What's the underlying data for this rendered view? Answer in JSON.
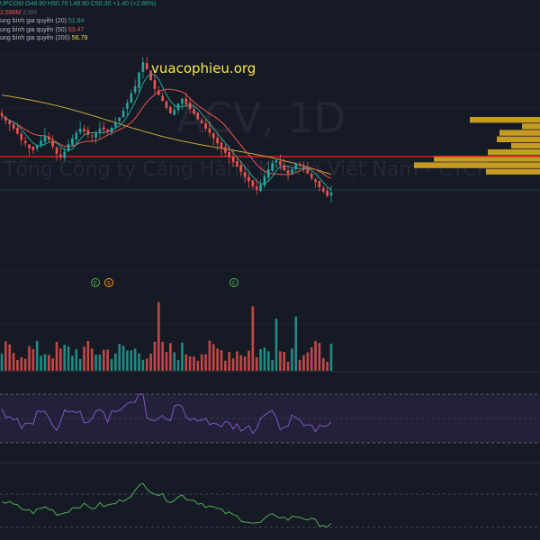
{
  "legend": {
    "ohlc": "UPCOM O48.90 H50.70 L48.90 C50.30 +1.40 (+2.86%)",
    "volume_value": "2.598M",
    "volume_extra": "2.5M",
    "ma20_label": "ung bình gia quyền (20)",
    "ma20_value": "51.84",
    "ma50_label": "ung bình gia quyền (50)",
    "ma50_value": "53.47",
    "ma200_label": "ung bình gia quyền (200)",
    "ma200_value": "56.79"
  },
  "watermark": {
    "title": "ACV, 1D",
    "subtitle": "Tổng Công ty Cảng Hàng Không Việt Nam - CTCP"
  },
  "site_label": "vuacophieu.org",
  "event_markers": [
    {
      "letter": "E",
      "kind": "earnings"
    },
    {
      "letter": "S",
      "kind": "split"
    },
    {
      "letter": "E",
      "kind": "earnings"
    }
  ],
  "colors": {
    "background": "#161a25",
    "up": "#26a69a",
    "down": "#ef5350",
    "ma20": "#26a69a",
    "ma50": "#ef5350",
    "ma200": "#c8a53a",
    "support_line": "#ff1f1f",
    "volume_profile": "#e6b31e",
    "rsi": "#7e57c2",
    "lower_indicator": "#4caf50",
    "site_label": "#f7e54a"
  },
  "chart_data": {
    "type": "candlestick",
    "close": [
      57.8,
      57.2,
      56.8,
      56.3,
      55.7,
      55.0,
      54.6,
      54.0,
      53.8,
      54.3,
      54.9,
      55.5,
      55.0,
      54.2,
      53.4,
      53.0,
      53.6,
      54.5,
      55.2,
      55.8,
      56.3,
      56.0,
      55.6,
      55.4,
      55.8,
      56.3,
      56.2,
      55.9,
      56.4,
      57.0,
      57.6,
      58.4,
      59.3,
      60.4,
      61.2,
      62.8,
      64.0,
      63.2,
      61.9,
      60.9,
      60.2,
      59.5,
      58.7,
      58.1,
      58.5,
      59.2,
      59.8,
      59.1,
      58.6,
      58.0,
      57.4,
      56.9,
      56.3,
      55.8,
      55.2,
      54.6,
      54.0,
      53.5,
      53.0,
      52.4,
      51.9,
      51.3,
      50.7,
      50.2,
      49.6,
      49.2,
      49.8,
      50.8,
      51.6,
      52.3,
      52.6,
      52.1,
      51.5,
      51.1,
      51.6,
      52.2,
      52.0,
      51.6,
      51.1,
      50.6,
      50.1,
      49.5,
      49.0,
      48.5,
      48.9
    ]
  }
}
